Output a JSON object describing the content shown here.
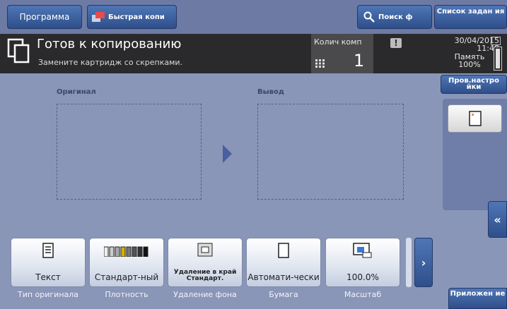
{
  "top_bar": {
    "program": "Программа",
    "quick_copy": "Быстрая копи",
    "search": "Поиск ф",
    "job_list": "Список задан ия"
  },
  "status": {
    "title": "Готов к копированию",
    "message": "Замените картридж со скрепками.",
    "count_label": "Колич комп",
    "count_value": "1",
    "date": "30/04/2015",
    "time": "11:48",
    "memory_label": "Память",
    "memory_value": "100%",
    "memory_level": 1.0
  },
  "main": {
    "original_label": "Оригинал",
    "output_label": "Вывод"
  },
  "right_panel": {
    "check_settings": "Пров.настро йки",
    "applications": "Приложен ие"
  },
  "functions": [
    {
      "value": "Текст",
      "caption": "Тип оригинала",
      "icon": "document-text-icon"
    },
    {
      "value": "Стандарт-ный",
      "caption": "Плотность",
      "icon": "density-scale-icon"
    },
    {
      "value": "Удаление в край Стандарт.",
      "caption": "Удаление фона",
      "icon": "edge-erase-icon"
    },
    {
      "value": "Автомати-чески",
      "caption": "Бумага",
      "icon": "paper-icon"
    },
    {
      "value": "100.0%",
      "caption": "Масштаб",
      "icon": "zoom-icon"
    }
  ],
  "colors": {
    "accent_blue": "#2f4f8a",
    "status_bar": "#2a2a2c",
    "background": "#8a96b8"
  }
}
